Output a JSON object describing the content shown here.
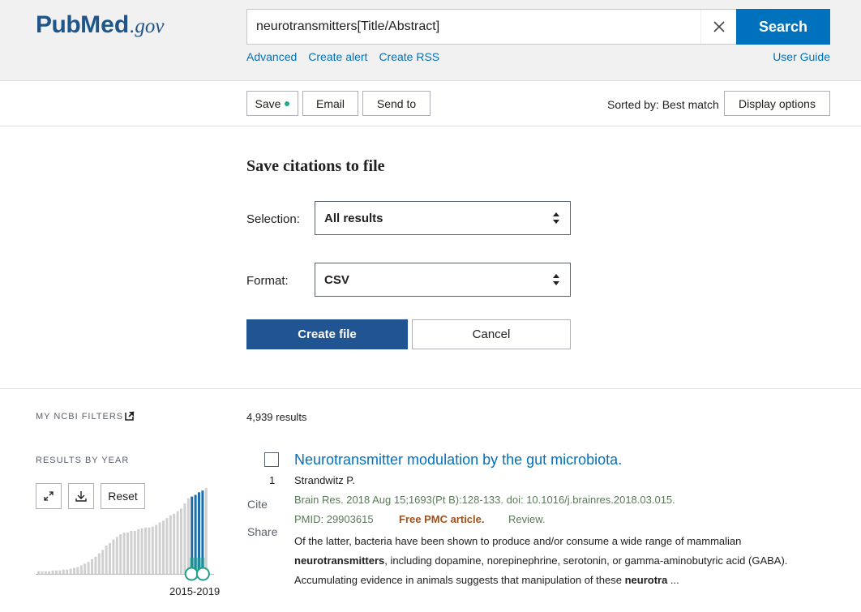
{
  "header": {
    "logo": {
      "pub": "Pub",
      "med": "Med",
      "gov": ".gov"
    },
    "search": {
      "value": "neurotransmitters[Title/Abstract]",
      "button": "Search"
    },
    "links": [
      "Advanced",
      "Create alert",
      "Create RSS"
    ],
    "user_guide": "User Guide"
  },
  "toolbar": {
    "save": "Save",
    "email": "Email",
    "send_to": "Send to",
    "sorted_by": "Sorted by: Best match",
    "display_options": "Display options"
  },
  "save_panel": {
    "title": "Save citations to file",
    "selection_label": "Selection:",
    "selection_value": "All results",
    "format_label": "Format:",
    "format_value": "CSV",
    "create_button": "Create file",
    "cancel_button": "Cancel"
  },
  "sidebar": {
    "my_ncbi_filters": "MY NCBI FILTERS",
    "results_by_year": "RESULTS BY YEAR",
    "reset": "Reset",
    "year_range": "2015-2019"
  },
  "results": {
    "count": "4,939 results",
    "items": [
      {
        "number": "1",
        "cite": "Cite",
        "share": "Share",
        "title": "Neurotransmitter modulation by the gut microbiota.",
        "authors": "Strandwitz P.",
        "citation": "Brain Res. 2018 Aug 15;1693(Pt B):128-133. doi: 10.1016/j.brainres.2018.03.015.",
        "pmid": "PMID: 29903615",
        "free": "Free PMC article.",
        "type": "Review.",
        "snippet": {
          "part1": "Of the latter, bacteria have been shown to produce and/or consume a wide range of mammalian ",
          "bold1": "neurotransmitters",
          "part2": ", including dopamine, norepinephrine, serotonin, or gamma-aminobutyric acid (GABA). Accumulating evidence in animals suggests that manipulation of these ",
          "bold2": "neurotra",
          "part3": " ..."
        }
      }
    ]
  },
  "chart_data": {
    "type": "bar",
    "title": "",
    "highlight_color": "#1e6fa8",
    "base_color": "#d0d0d0",
    "selected_range": "2015-2019",
    "values": [
      3,
      3,
      3,
      3,
      4,
      4,
      4,
      5,
      5,
      6,
      7,
      8,
      10,
      12,
      14,
      17,
      20,
      24,
      28,
      33,
      36,
      40,
      43,
      46,
      48,
      48,
      50,
      50,
      52,
      53,
      54,
      54,
      55,
      57,
      60,
      62,
      65,
      68,
      70,
      73,
      76,
      82,
      88,
      90,
      92,
      95,
      97,
      100
    ],
    "highlighted_from_index": 43,
    "highlighted_to_index": 46
  },
  "colors": {
    "brand": "#20558a",
    "link": "#0071bc",
    "primary_button": "#205493",
    "search_button": "#0071bc",
    "free_pmc": "#a0511b"
  }
}
